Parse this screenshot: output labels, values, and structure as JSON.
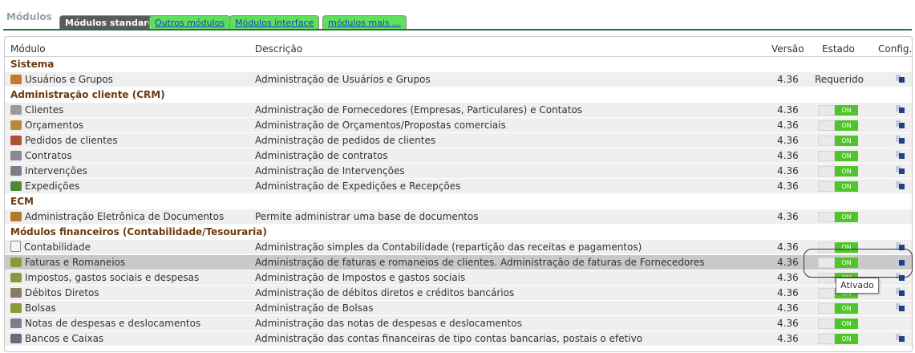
{
  "tabs": {
    "title": "Módulos",
    "items": [
      {
        "label": "Módulos standard",
        "active": true
      },
      {
        "label": "Outros módulos",
        "active": false
      },
      {
        "label": "Módulos interface",
        "active": false
      },
      {
        "label": "módulos mais ...",
        "active": false
      }
    ]
  },
  "table": {
    "headers": {
      "module": "Módulo",
      "description": "Descrição",
      "version": "Versão",
      "state": "Estado",
      "config": "Config."
    },
    "rows": [
      {
        "type": "group",
        "name": "Sistema"
      },
      {
        "type": "module",
        "name": "Usuários e Grupos",
        "description": "Administração de Usuários e Grupos",
        "version": "4.36",
        "state": "Requerido",
        "icon": "users-icon",
        "config": true
      },
      {
        "type": "group",
        "name": "Administração cliente (CRM)"
      },
      {
        "type": "module",
        "name": "Clientes",
        "description": "Administração de Fornecedores (Empresas, Particulares) e Contatos",
        "version": "4.36",
        "state": "ON",
        "icon": "building-icon",
        "config": true
      },
      {
        "type": "module",
        "name": "Orçamentos",
        "description": "Administração de Orçamentos/Propostas comerciais",
        "version": "4.36",
        "state": "ON",
        "icon": "proposal-icon",
        "config": true
      },
      {
        "type": "module",
        "name": "Pedidos de clientes",
        "description": "Administração de pedidos de clientes",
        "version": "4.36",
        "state": "ON",
        "icon": "order-icon",
        "config": true
      },
      {
        "type": "module",
        "name": "Contratos",
        "description": "Administração de contratos",
        "version": "4.36",
        "state": "ON",
        "icon": "contract-icon",
        "config": true
      },
      {
        "type": "module",
        "name": "Intervenções",
        "description": "Administração de Intervenções",
        "version": "4.36",
        "state": "ON",
        "icon": "intervention-icon",
        "config": true
      },
      {
        "type": "module",
        "name": "Expedições",
        "description": "Administração de Expedições e Recepções",
        "version": "4.36",
        "state": "ON",
        "icon": "truck-icon",
        "config": true
      },
      {
        "type": "group",
        "name": "ECM"
      },
      {
        "type": "module",
        "name": "Administração Eletrônica de Documentos",
        "description": "Permite administrar uma base de documentos",
        "version": "4.36",
        "state": "ON",
        "icon": "folder-icon",
        "config": false
      },
      {
        "type": "group",
        "name": "Módulos financeiros (Contabilidade/Tesouraria)"
      },
      {
        "type": "module",
        "name": "Contabilidade",
        "description": "Administração simples da Contabilidade (repartição das receitas e pagamentos)",
        "version": "4.36",
        "state": "ON",
        "icon": "page-icon",
        "config": true
      },
      {
        "type": "module",
        "name": "Faturas e Romaneios",
        "description": "Administração de faturas e romaneios de clientes. Administração de faturas de Fornecedores",
        "version": "4.36",
        "state": "ON",
        "icon": "invoice-icon",
        "config": true,
        "highlight": true
      },
      {
        "type": "module",
        "name": "Impostos, gastos sociais e despesas",
        "description": "Administração de Impostos e gastos sociais",
        "version": "4.36",
        "state": "ON",
        "icon": "invoice-icon",
        "config": true
      },
      {
        "type": "module",
        "name": "Débitos Diretos",
        "description": "Administração de débitos diretos e créditos bancários",
        "version": "4.36",
        "state": "ON",
        "icon": "debit-icon",
        "config": true
      },
      {
        "type": "module",
        "name": "Bolsas",
        "description": "Administração de Bolsas",
        "version": "4.36",
        "state": "ON",
        "icon": "invoice-icon",
        "config": true
      },
      {
        "type": "module",
        "name": "Notas de despesas e deslocamentos",
        "description": "Administração das notas de despesas e deslocamentos",
        "version": "4.36",
        "state": "ON",
        "icon": "intervention-icon",
        "config": false
      },
      {
        "type": "module",
        "name": "Bancos e Caixas",
        "description": "Administração das contas financeiras de tipo contas bancarias, postais o efetivo",
        "version": "4.36",
        "state": "ON",
        "icon": "bank-icon",
        "config": true
      }
    ]
  },
  "tooltip": {
    "text": "Ativado"
  },
  "colors": {
    "on": "#4fc52a",
    "group_text": "#6b3a0e",
    "active_tab": "#5b5b5b",
    "inactive_tab": "#5fe05c"
  }
}
